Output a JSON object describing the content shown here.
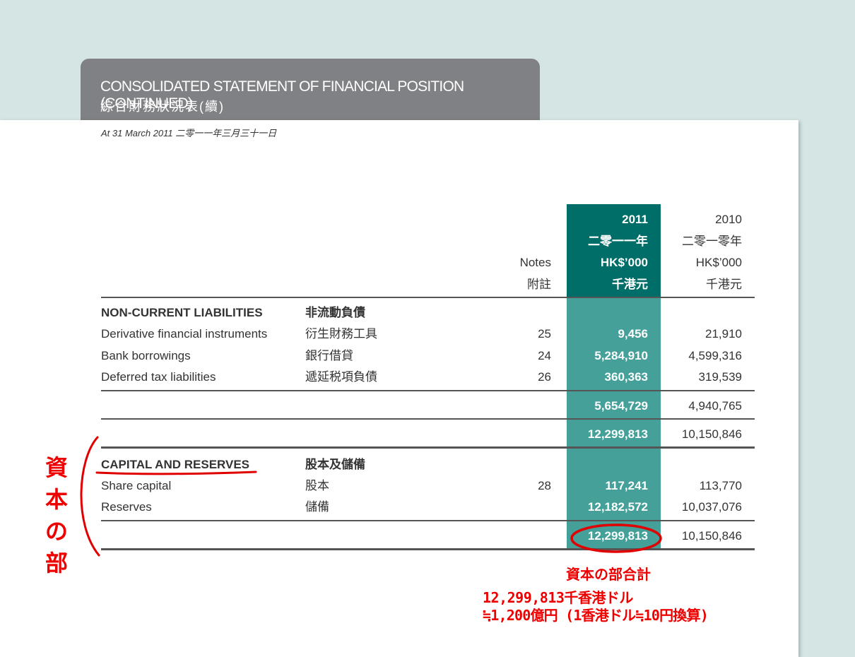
{
  "header": {
    "title_en": "CONSOLIDATED STATEMENT OF FINANCIAL POSITION (CONTINUED)",
    "title_zh": "綜合財務狀況表(續)",
    "date": "At 31 March 2011   二零一一年三月三十一日"
  },
  "columns": {
    "notes_en": "Notes",
    "notes_zh": "附註",
    "y2011": "2011",
    "y2011_zh": "二零一一年",
    "unit2011": "HK$’000",
    "unit2011_zh": "千港元",
    "y2010": "2010",
    "y2010_zh": "二零一零年",
    "unit2010": "HK$’000",
    "unit2010_zh": "千港元"
  },
  "ncl": {
    "heading_en": "NON-CURRENT LIABILITIES",
    "heading_zh": "非流動負債",
    "rows": [
      {
        "en": "Derivative financial instruments",
        "zh": "衍生財務工具",
        "note": "25",
        "v2011": "9,456",
        "v2010": "21,910"
      },
      {
        "en": "Bank borrowings",
        "zh": "銀行借貸",
        "note": "24",
        "v2011": "5,284,910",
        "v2010": "4,599,316"
      },
      {
        "en": "Deferred tax liabilities",
        "zh": "遞延税項負債",
        "note": "26",
        "v2011": "360,363",
        "v2010": "319,539"
      }
    ],
    "subtotal_2011": "5,654,729",
    "subtotal_2010": "4,940,765",
    "total_2011": "12,299,813",
    "total_2010": "10,150,846"
  },
  "cap": {
    "heading_en": "CAPITAL AND RESERVES",
    "heading_zh": "股本及儲備",
    "rows": [
      {
        "en": "Share capital",
        "zh": "股本",
        "note": "28",
        "v2011": "117,241",
        "v2010": "113,770"
      },
      {
        "en": "Reserves",
        "zh": "儲備",
        "note": "",
        "v2011": "12,182,572",
        "v2010": "10,037,076"
      }
    ],
    "total_2011": "12,299,813",
    "total_2010": "10,150,846"
  },
  "annotations": {
    "side_label": "資本の部",
    "total_label": "資本の部合計",
    "amount_line": "12,299,813千香港ドル",
    "yen_line": "≒1,200億円 (1香港ドル≒10円換算)",
    "color": "#e00000"
  }
}
